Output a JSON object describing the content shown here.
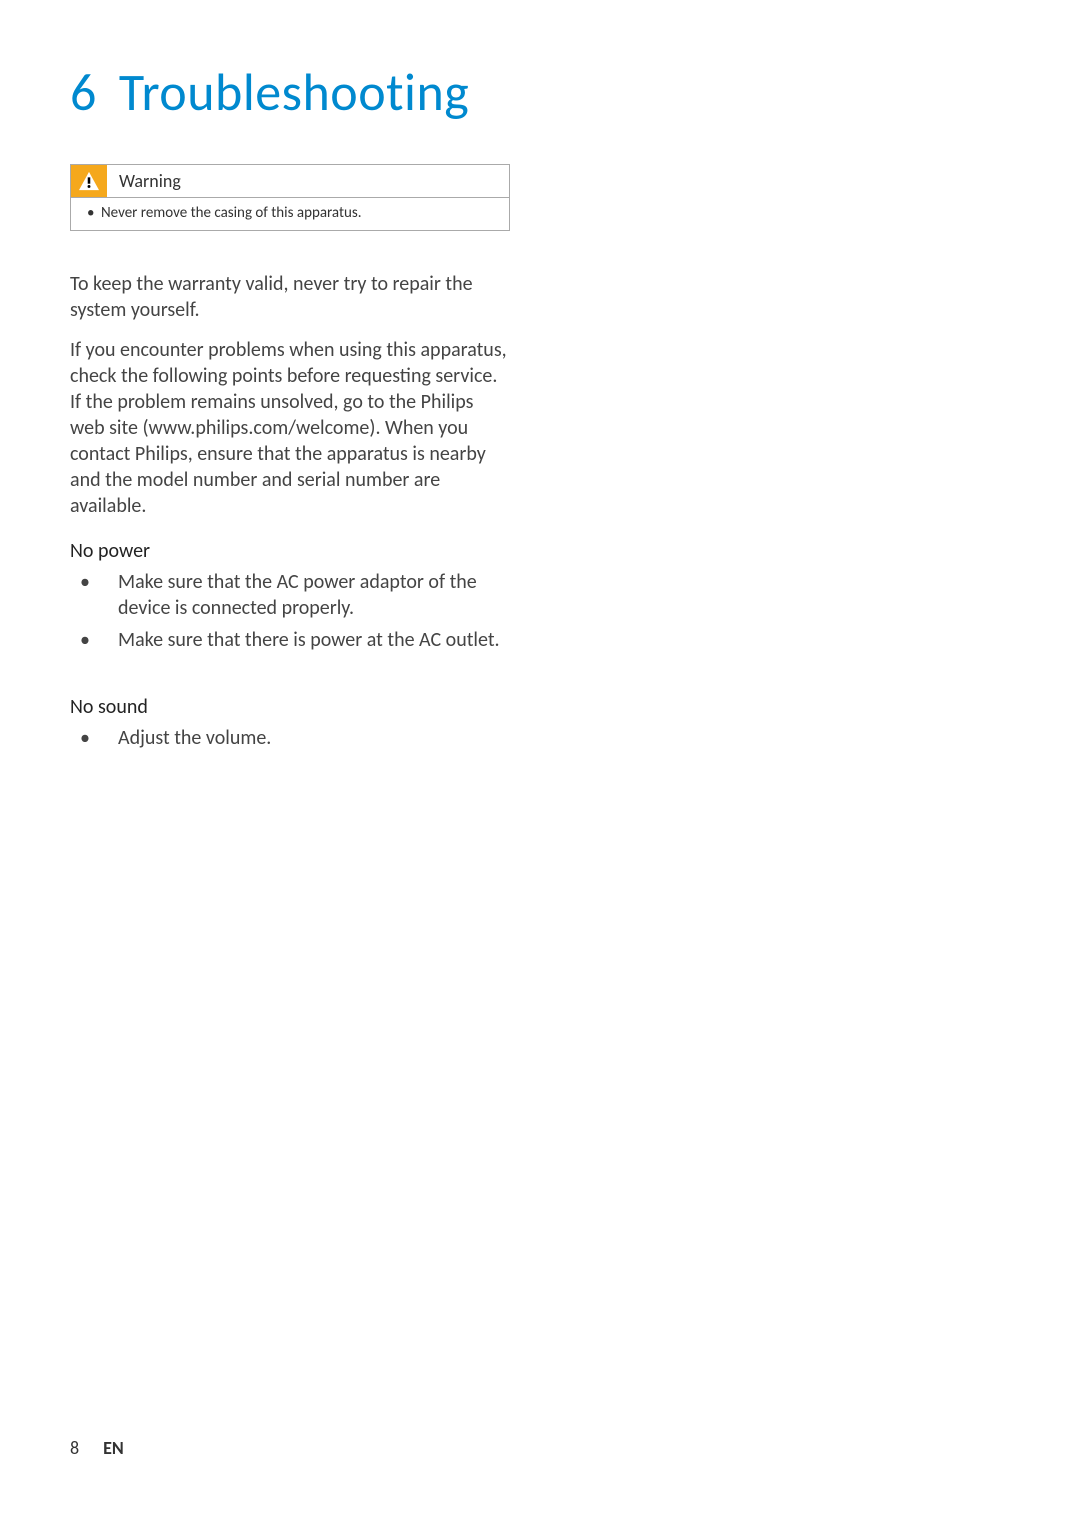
{
  "heading": {
    "number": "6",
    "title": "Troubleshooting"
  },
  "warning": {
    "label": "Warning",
    "items": [
      "Never remove the casing of this apparatus."
    ]
  },
  "paragraphs": [
    "To keep the warranty valid, never try to repair the system yourself.",
    "If you encounter problems when using this apparatus, check the following points before requesting service. If the problem remains unsolved, go to the Philips web site (www.philips.com/welcome). When you contact Philips, ensure that the apparatus is nearby and the model number and serial number are available."
  ],
  "sections": [
    {
      "head": "No power",
      "items": [
        "Make sure that the AC power adaptor of the device is connected properly.",
        "Make sure that there is power at the AC outlet."
      ]
    },
    {
      "head": "No sound",
      "items": [
        "Adjust the volume."
      ]
    }
  ],
  "footer": {
    "page": "8",
    "lang": "EN"
  }
}
